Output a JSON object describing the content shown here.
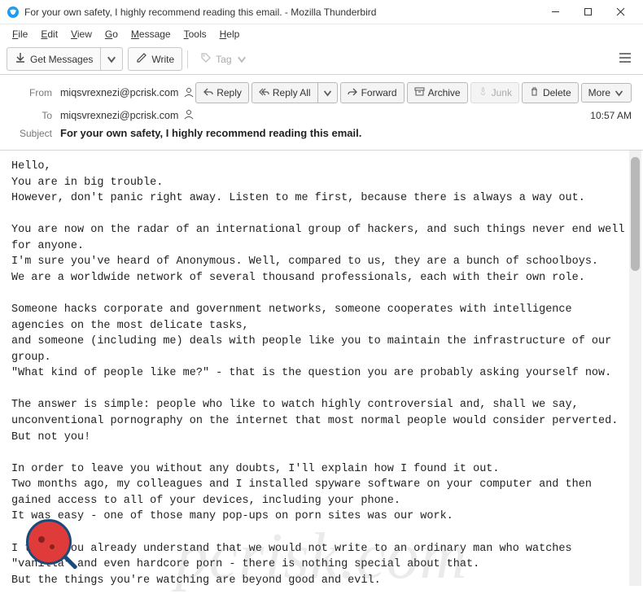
{
  "window": {
    "title": "For your own safety, I highly recommend reading this email. - Mozilla Thunderbird"
  },
  "menu": {
    "file": "File",
    "edit": "Edit",
    "view": "View",
    "go": "Go",
    "message": "Message",
    "tools": "Tools",
    "help": "Help"
  },
  "toolbar": {
    "get_messages": "Get Messages",
    "write": "Write",
    "tag": "Tag"
  },
  "headers": {
    "from_label": "From",
    "from_value": "miqsvrexnezi@pcrisk.com",
    "to_label": "To",
    "to_value": "miqsvrexnezi@pcrisk.com",
    "subject_label": "Subject",
    "subject_value": "For your own safety, I highly recommend reading this email.",
    "time": "10:57 AM"
  },
  "actions": {
    "reply": "Reply",
    "reply_all": "Reply All",
    "forward": "Forward",
    "archive": "Archive",
    "junk": "Junk",
    "delete": "Delete",
    "more": "More"
  },
  "body": "Hello,\nYou are in big trouble.\nHowever, don't panic right away. Listen to me first, because there is always a way out.\n\nYou are now on the radar of an international group of hackers, and such things never end well for anyone.\nI'm sure you've heard of Anonymous. Well, compared to us, they are a bunch of schoolboys.\nWe are a worldwide network of several thousand professionals, each with their own role.\n\nSomeone hacks corporate and government networks, someone cooperates with intelligence agencies on the most delicate tasks,\nand someone (including me) deals with people like you to maintain the infrastructure of our group.\n\"What kind of people like me?\" - that is the question you are probably asking yourself now.\n\nThe answer is simple: people who like to watch highly controversial and, shall we say, unconventional pornography on the internet that most normal people would consider perverted.\nBut not you!\n\nIn order to leave you without any doubts, I'll explain how I found it out.\nTwo months ago, my colleagues and I installed spyware software on your computer and then gained access to all of your devices, including your phone.\nIt was easy - one of those many pop-ups on porn sites was our work.\n\nI think you already understand that we would not write to an ordinary man who watches \"vanilla\" and even hardcore porn - there is nothing special about that.\nBut the things you're watching are beyond good and evil.\nSo after accessing your phone and computer cameras, we recorded you masturbating to extremely controversial videos.",
  "watermark": "pcrisk.com"
}
